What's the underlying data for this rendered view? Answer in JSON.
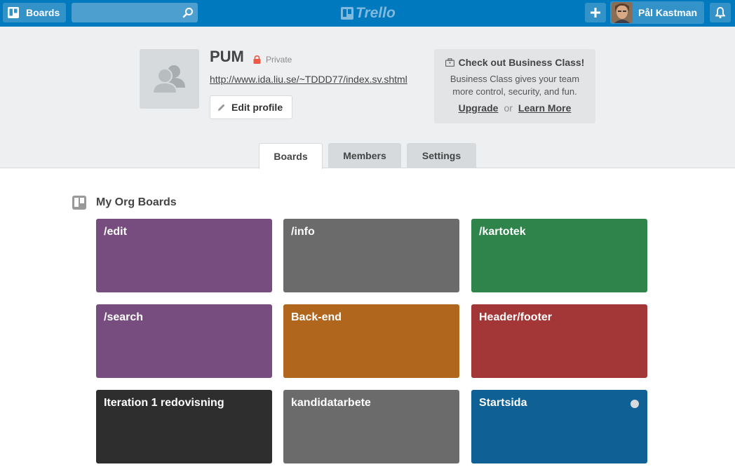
{
  "header": {
    "boards_label": "Boards",
    "logo_text": "Trello",
    "member_name": "Pål Kastman"
  },
  "org": {
    "name": "PUM",
    "visibility": "Private",
    "url": "http://www.ida.liu.se/~TDDD77/index.sv.shtml",
    "edit_label": "Edit profile"
  },
  "promo": {
    "title": "Check out Business Class!",
    "text": "Business Class gives your team more control, security, and fun.",
    "upgrade": "Upgrade",
    "or": "or",
    "learn_more": "Learn More"
  },
  "tabs": [
    {
      "label": "Boards",
      "active": true
    },
    {
      "label": "Members",
      "active": false
    },
    {
      "label": "Settings",
      "active": false
    }
  ],
  "section": {
    "title": "My Org Boards"
  },
  "boards": [
    {
      "name": "/edit",
      "color": "#774d7f"
    },
    {
      "name": "/info",
      "color": "#6b6b6b"
    },
    {
      "name": "/kartotek",
      "color": "#2e844b"
    },
    {
      "name": "/search",
      "color": "#774d7f"
    },
    {
      "name": "Back-end",
      "color": "#b0661c"
    },
    {
      "name": "Header/footer",
      "color": "#a33637"
    },
    {
      "name": "Iteration 1 redovisning",
      "color": "#2e2e2e"
    },
    {
      "name": "kandidatarbete",
      "color": "#6b6b6b"
    },
    {
      "name": "Startsida",
      "color": "#0e6095"
    }
  ],
  "colors": {
    "header_bg": "#0079bf",
    "org_header_bg": "#edeff0"
  }
}
